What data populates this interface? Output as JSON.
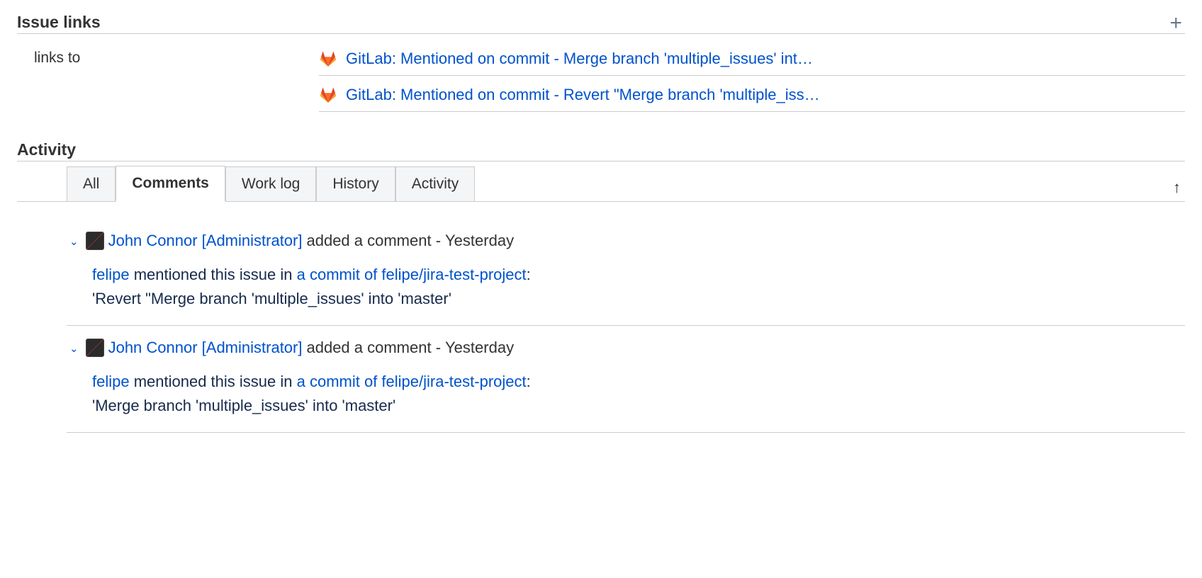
{
  "issue_links": {
    "title": "Issue links",
    "label": "links to",
    "items": [
      {
        "text": "GitLab: Mentioned on commit - Merge branch 'multiple_issues' int…"
      },
      {
        "text": "GitLab: Mentioned on commit - Revert \"Merge branch 'multiple_iss…"
      }
    ]
  },
  "activity": {
    "title": "Activity",
    "tabs": [
      {
        "label": "All",
        "active": false
      },
      {
        "label": "Comments",
        "active": true
      },
      {
        "label": "Work log",
        "active": false
      },
      {
        "label": "History",
        "active": false
      },
      {
        "label": "Activity",
        "active": false
      }
    ]
  },
  "comments": [
    {
      "user": "John Connor [Administrator]",
      "action_text": " added a comment - ",
      "timestamp": "Yesterday",
      "body_user": "felipe",
      "body_mid": " mentioned this issue in ",
      "body_link": "a commit of felipe/jira-test-project",
      "body_colon": ":",
      "body_quote": "'Revert \"Merge branch 'multiple_issues' into 'master'"
    },
    {
      "user": "John Connor [Administrator]",
      "action_text": " added a comment - ",
      "timestamp": "Yesterday",
      "body_user": "felipe",
      "body_mid": " mentioned this issue in ",
      "body_link": "a commit of felipe/jira-test-project",
      "body_colon": ":",
      "body_quote": "'Merge branch 'multiple_issues' into 'master'"
    }
  ]
}
